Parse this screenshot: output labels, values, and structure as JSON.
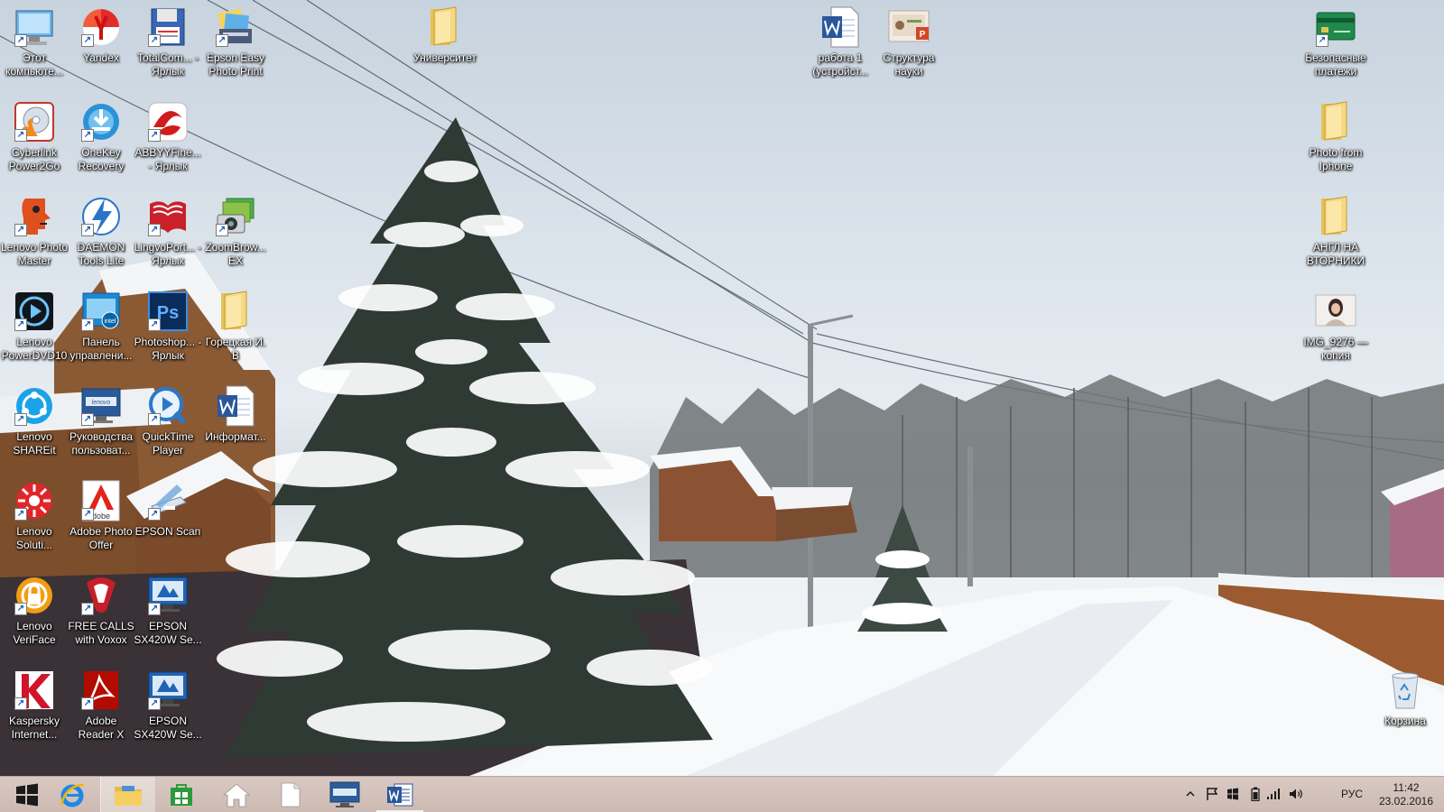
{
  "desktop": {
    "icons": [
      {
        "id": "this-pc",
        "label": "Этот компьюте...",
        "icon": "computer-icon",
        "shortcut": true
      },
      {
        "id": "yandex",
        "label": "Yandex",
        "icon": "yandex-browser-icon",
        "shortcut": true
      },
      {
        "id": "totalcommander",
        "label": "TotalCom... - Ярлык",
        "icon": "floppy-disk-icon",
        "shortcut": true
      },
      {
        "id": "epson-easy-photo-print",
        "label": "Epson Easy Photo Print",
        "icon": "photo-print-icon",
        "shortcut": true
      },
      {
        "id": "cyberlink-power2go",
        "label": "Cyberlink Power2Go",
        "icon": "disc-burn-icon",
        "shortcut": true
      },
      {
        "id": "onekey-recovery",
        "label": "OneKey Recovery",
        "icon": "recovery-icon",
        "shortcut": true
      },
      {
        "id": "abbyy-finereader",
        "label": "ABBYYFine... - Ярлык",
        "icon": "abbyy-icon",
        "shortcut": true
      },
      {
        "id": "lenovo-photo-master",
        "label": "Lenovo Photo Master",
        "icon": "face-profile-icon",
        "shortcut": true
      },
      {
        "id": "daemon-tools",
        "label": "DAEMON Tools Lite",
        "icon": "lightning-icon",
        "shortcut": true
      },
      {
        "id": "lingvoport",
        "label": "LingvoPort... - Ярлык",
        "icon": "book-icon",
        "shortcut": true
      },
      {
        "id": "zoombrowser",
        "label": "ZoomBrow... EX",
        "icon": "camera-photos-icon",
        "shortcut": true
      },
      {
        "id": "lenovo-powerdvd",
        "label": "Lenovo PowerDVD10",
        "icon": "play-disc-icon",
        "shortcut": true
      },
      {
        "id": "control-panel",
        "label": "Панель управлени...",
        "icon": "intel-panel-icon",
        "shortcut": true
      },
      {
        "id": "photoshop",
        "label": "Photoshop... - Ярлык",
        "icon": "photoshop-icon",
        "shortcut": true
      },
      {
        "id": "goretskaya-folder",
        "label": "Горецкая И. В",
        "icon": "folder-icon",
        "shortcut": false
      },
      {
        "id": "lenovo-shareit",
        "label": "Lenovo SHAREit",
        "icon": "share-icon",
        "shortcut": true
      },
      {
        "id": "user-guides",
        "label": "Руководства пользоват...",
        "icon": "lenovo-monitor-icon",
        "shortcut": true
      },
      {
        "id": "quicktime",
        "label": "QuickTime Player",
        "icon": "quicktime-icon",
        "shortcut": true
      },
      {
        "id": "informatika-doc",
        "label": "Информат...",
        "icon": "word-doc-icon",
        "shortcut": false
      },
      {
        "id": "lenovo-solution",
        "label": "Lenovo Soluti...",
        "icon": "lenovo-solution-icon",
        "shortcut": true
      },
      {
        "id": "adobe-photo-offer",
        "label": "Adobe Photo Offer",
        "icon": "adobe-icon",
        "shortcut": true
      },
      {
        "id": "epson-scan",
        "label": "EPSON Scan",
        "icon": "scanner-icon",
        "shortcut": true
      },
      {
        "id": "lenovo-veriface",
        "label": "Lenovo VeriFace",
        "icon": "lock-face-icon",
        "shortcut": true
      },
      {
        "id": "voxox",
        "label": "FREE CALLS with Voxox",
        "icon": "voxox-icon",
        "shortcut": true
      },
      {
        "id": "epson-sx420w-1",
        "label": "EPSON SX420W Se...",
        "icon": "epson-monitor-icon",
        "shortcut": true
      },
      {
        "id": "kaspersky",
        "label": "Kaspersky Internet...",
        "icon": "kaspersky-icon",
        "shortcut": true
      },
      {
        "id": "adobe-reader",
        "label": "Adobe Reader X",
        "icon": "pdf-icon",
        "shortcut": true
      },
      {
        "id": "epson-sx420w-2",
        "label": "EPSON SX420W Se...",
        "icon": "epson-monitor-icon",
        "shortcut": true
      },
      {
        "id": "universitet-folder",
        "label": "Университет",
        "icon": "folder-icon",
        "shortcut": false
      },
      {
        "id": "rabota-doc",
        "label": "работа 1 (устройст...",
        "icon": "word-doc-icon",
        "shortcut": false
      },
      {
        "id": "struktura-ppt",
        "label": "Структура науки",
        "icon": "powerpoint-icon",
        "shortcut": false
      },
      {
        "id": "safe-payments",
        "label": "Безопасные платежи",
        "icon": "credit-card-icon",
        "shortcut": true
      },
      {
        "id": "photo-iphone-folder",
        "label": "Photo from Iphone",
        "icon": "folder-icon",
        "shortcut": false
      },
      {
        "id": "angl-folder",
        "label": "АНГЛ НА ВТОРНИКИ",
        "icon": "folder-icon",
        "shortcut": false
      },
      {
        "id": "img-9276",
        "label": "IMG_9276 — копия",
        "icon": "photo-thumbnail-icon",
        "shortcut": false
      },
      {
        "id": "recycle-bin",
        "label": "Корзина",
        "icon": "recycle-bin-icon",
        "shortcut": false
      }
    ]
  },
  "taskbar": {
    "buttons": [
      {
        "id": "start",
        "icon": "windows-logo-icon"
      },
      {
        "id": "ie",
        "icon": "internet-explorer-icon"
      },
      {
        "id": "explorer",
        "icon": "file-explorer-icon",
        "active": true
      },
      {
        "id": "store",
        "icon": "store-icon"
      },
      {
        "id": "home",
        "icon": "home-icon"
      },
      {
        "id": "blank-doc",
        "icon": "document-icon"
      },
      {
        "id": "lenovo",
        "icon": "lenovo-monitor-icon"
      },
      {
        "id": "word",
        "icon": "word-icon",
        "open": true
      }
    ],
    "tray": {
      "icons": [
        "chevron-up-icon",
        "flag-icon",
        "windows-small-icon",
        "battery-icon",
        "signal-icon",
        "speaker-icon"
      ],
      "language": "РУС",
      "time": "11:42",
      "date": "23.02.2016"
    }
  },
  "colors": {
    "taskbar": "#cdbbb3",
    "label_text": "#ffffff",
    "accent_word": "#2b579a"
  }
}
